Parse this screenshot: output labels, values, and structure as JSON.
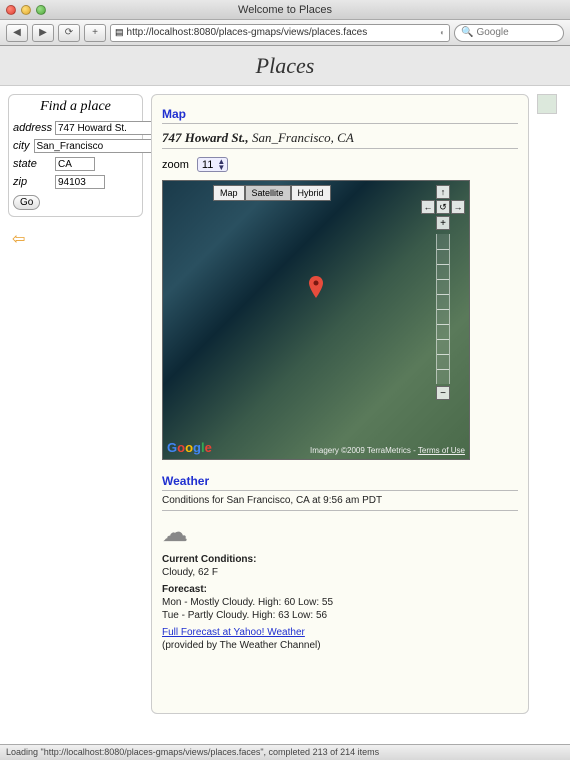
{
  "window": {
    "title": "Welcome to Places"
  },
  "toolbar": {
    "url": "http://localhost:8080/places-gmaps/views/places.faces",
    "search_placeholder": "Google"
  },
  "header": {
    "title": "Places"
  },
  "find": {
    "title": "Find a place",
    "address_label": "address",
    "address_value": "747 Howard St.",
    "city_label": "city",
    "city_value": "San_Francisco",
    "state_label": "state",
    "state_value": "CA",
    "zip_label": "zip",
    "zip_value": "94103",
    "go_label": "Go"
  },
  "map": {
    "title": "Map",
    "address_street": "747 Howard St.,",
    "address_rest": " San_Francisco, CA",
    "zoom_label": "zoom",
    "zoom_value": "11",
    "type_map": "Map",
    "type_sat": "Satellite",
    "type_hybrid": "Hybrid",
    "credit": "Imagery ©2009 TerraMetrics - ",
    "terms": "Terms of Use"
  },
  "weather": {
    "title": "Weather",
    "conditions": "Conditions for San Francisco, CA at 9:56 am PDT",
    "current_label": "Current Conditions:",
    "current_value": "Cloudy, 62 F",
    "forecast_label": "Forecast:",
    "f1": "Mon - Mostly Cloudy. High: 60 Low: 55",
    "f2": "Tue - Partly Cloudy. High: 63 Low: 56",
    "link": "Full Forecast at Yahoo! Weather",
    "provider": "(provided by The Weather Channel)"
  },
  "status": {
    "text": "Loading \"http://localhost:8080/places-gmaps/views/places.faces\", completed 213 of 214 items"
  }
}
